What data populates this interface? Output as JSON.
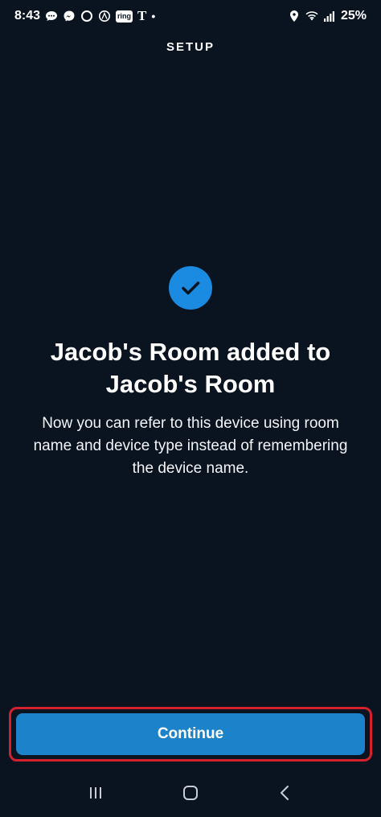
{
  "status_bar": {
    "time": "8:43",
    "left_icons": [
      "chat-bubble-icon",
      "messenger-icon",
      "circle-icon",
      "alexa-ring-icon",
      "ring-app-icon",
      "tmobile-icon",
      "dot-icon"
    ],
    "ring_label": "ring",
    "carrier_glyph": "T",
    "dot": "•",
    "right_icons": [
      "location-icon",
      "wifi-icon",
      "signal-icon"
    ],
    "battery": "25%"
  },
  "header": {
    "title": "SETUP"
  },
  "content": {
    "icon": "check-icon",
    "headline": "Jacob's Room added to Jacob's Room",
    "description": "Now you can refer to this device using room name and device type instead of remembering the device name."
  },
  "actions": {
    "continue_label": "Continue"
  },
  "nav_bar": {
    "items": [
      "recents-icon",
      "home-icon",
      "back-icon"
    ]
  },
  "colors": {
    "background": "#0a1421",
    "accent": "#1c82c9",
    "check_badge": "#1a8be0",
    "highlight_border": "#d3222d"
  }
}
